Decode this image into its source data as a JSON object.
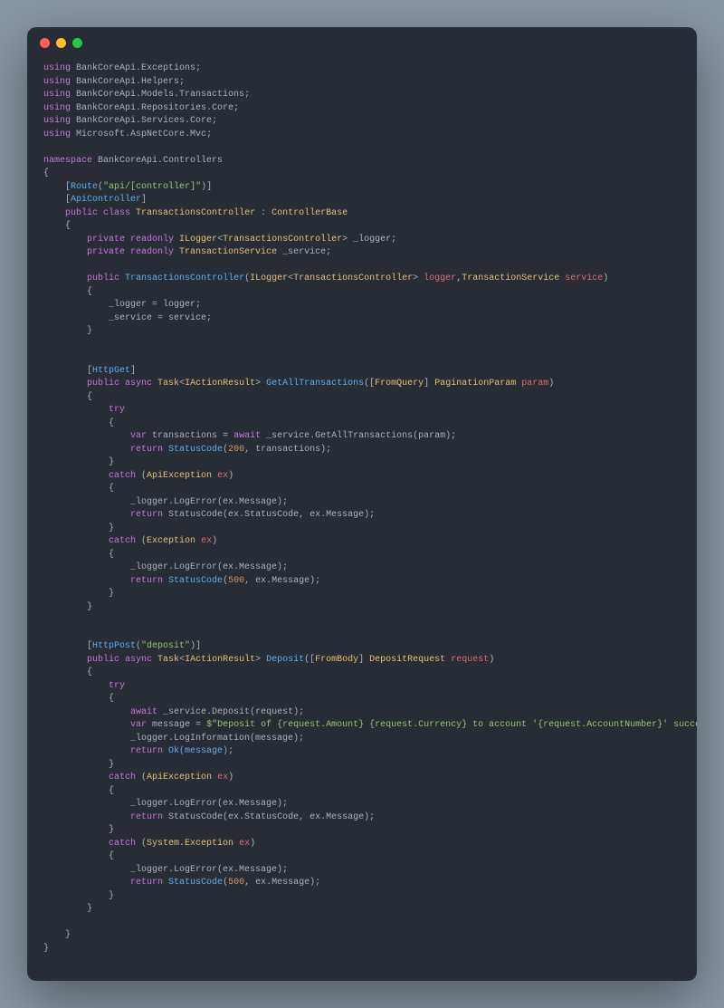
{
  "window": {
    "dots": [
      "close",
      "minimize",
      "maximize"
    ]
  },
  "code": {
    "using": [
      "BankCoreApi.Exceptions",
      "BankCoreApi.Helpers",
      "BankCoreApi.Models.Transactions",
      "BankCoreApi.Repositories.Core",
      "BankCoreApi.Services.Core",
      "Microsoft.AspNetCore.Mvc"
    ],
    "namespace": "BankCoreApi.Controllers",
    "route_attr": "Route",
    "route_val": "\"api/[controller]\"",
    "api_attr": "ApiController",
    "class_kw": "public class",
    "class_name": "TransactionsController",
    "base_class": "ControllerBase",
    "field1_mod": "private readonly",
    "field1_type": "ILogger",
    "field1_gen": "TransactionsController",
    "field1_name": "_logger",
    "field2_mod": "private readonly",
    "field2_type": "TransactionService",
    "field2_name": "_service",
    "ctor_mod": "public",
    "ctor_name": "TransactionsController",
    "ctor_p1t": "ILogger",
    "ctor_p1g": "TransactionsController",
    "ctor_p1n": "logger",
    "ctor_p2t": "TransactionService",
    "ctor_p2n": "service",
    "ctor_b1": "_logger = logger;",
    "ctor_b2": "_service = service;",
    "m1_attr": "HttpGet",
    "m1_mod": "public async",
    "m1_ret": "Task",
    "m1_gen": "IActionResult",
    "m1_name": "GetAllTransactions",
    "m1_pattr": "FromQuery",
    "m1_ptype": "PaginationParam",
    "m1_pname": "param",
    "m1_try": "try",
    "m1_var": "var",
    "m1_varname": "transactions",
    "m1_await": "await",
    "m1_call": "_service.GetAllTransactions(param)",
    "m1_ret1": "return",
    "m1_sc1": "StatusCode",
    "m1_sc1a": "200",
    "m1_sc1b": "transactions",
    "m1_catch1": "catch",
    "m1_ex1t": "ApiException",
    "m1_ex1n": "ex",
    "m1_log1": "_logger.LogError(ex.Message);",
    "m1_ret2": "return",
    "m1_sc2": "StatusCode(ex.StatusCode, ex.Message)",
    "m1_catch2": "catch",
    "m1_ex2t": "Exception",
    "m1_ex2n": "ex",
    "m1_log2": "_logger.LogError(ex.Message);",
    "m1_ret3": "return",
    "m1_sc3": "StatusCode",
    "m1_sc3a": "500",
    "m1_sc3b": "ex.Message",
    "m2_attr": "HttpPost",
    "m2_attrv": "\"deposit\"",
    "m2_mod": "public async",
    "m2_ret": "Task",
    "m2_gen": "IActionResult",
    "m2_name": "Deposit",
    "m2_pattr": "FromBody",
    "m2_ptype": "DepositRequest",
    "m2_pname": "request",
    "m2_try": "try",
    "m2_await": "await",
    "m2_call": "_service.Deposit(request)",
    "m2_var": "var",
    "m2_varname": "message",
    "m2_str": "$\"Deposit of {request.Amount} {request.Currency} to account '{request.AccountNumber}' successful.\"",
    "m2_log": "_logger.LogInformation(message);",
    "m2_ret1": "return",
    "m2_ok": "Ok(message)",
    "m2_catch1": "catch",
    "m2_ex1t": "ApiException",
    "m2_ex1n": "ex",
    "m2_log1": "_logger.LogError(ex.Message);",
    "m2_ret2": "return",
    "m2_sc2": "StatusCode(ex.StatusCode, ex.Message)",
    "m2_catch2": "catch",
    "m2_ex2t": "System.Exception",
    "m2_ex2n": "ex",
    "m2_log2": "_logger.LogError(ex.Message);",
    "m2_ret3": "return",
    "m2_sc3": "StatusCode",
    "m2_sc3a": "500",
    "m2_sc3b": "ex.Message"
  }
}
